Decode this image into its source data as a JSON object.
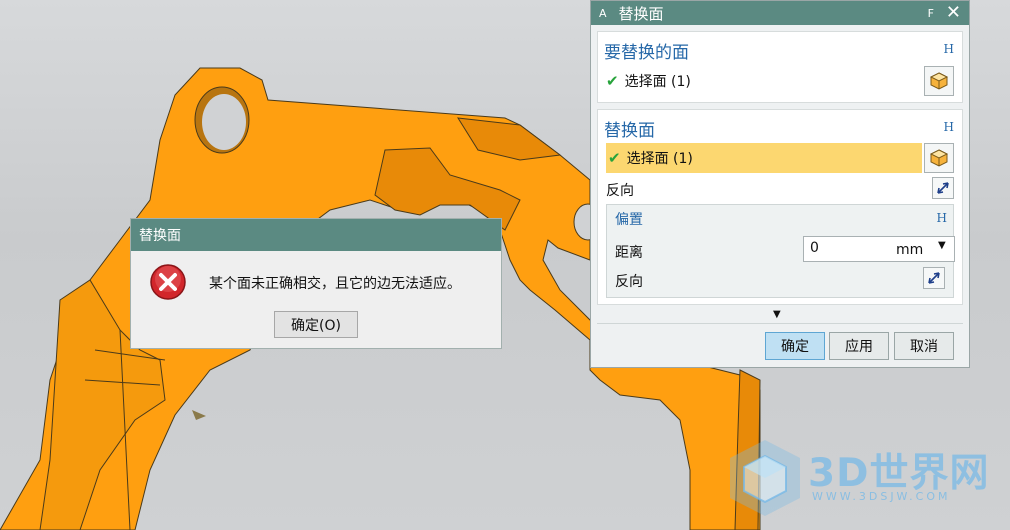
{
  "dialog": {
    "small_label": "A",
    "title": "替换面",
    "f_key": "F",
    "close_glyph": "✕",
    "sections": {
      "target": {
        "header": "要替换的面",
        "h_key": "H",
        "select_label": "选择面 (1)"
      },
      "replacement": {
        "header": "替换面",
        "h_key": "H",
        "select_label": "选择面 (1)",
        "reverse_label": "反向"
      },
      "offset": {
        "header": "偏置",
        "h_key": "H",
        "distance_label": "距离",
        "distance_value": "0",
        "distance_unit": "mm",
        "reverse_label": "反向"
      }
    },
    "buttons": {
      "ok": "确定",
      "apply": "应用",
      "cancel": "取消"
    }
  },
  "message_box": {
    "title": "替换面",
    "text": "某个面未正确相交，且它的边无法适应。",
    "ok_label": "确定(O)"
  },
  "watermark": {
    "text": "3D世界网",
    "url": "WWW.3DSJW.COM"
  },
  "colors": {
    "part_orange": "#ff9f10",
    "dialog_title_bar": "#5b8a82",
    "section_header_blue": "#2668a8",
    "selected_row": "#fcd770",
    "check_green": "#27a33b",
    "error_red": "#d2262b"
  },
  "icons": {
    "check": "checkmark-icon",
    "face_select": "face-select-cube-icon",
    "reverse": "reverse-direction-icon",
    "error": "error-x-icon",
    "expand": "expand-arrow-icon"
  }
}
